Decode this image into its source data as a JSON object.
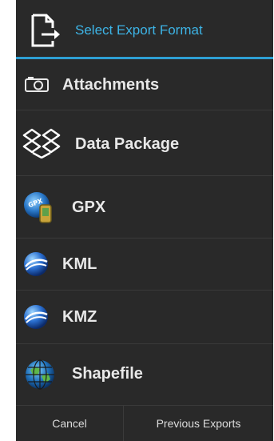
{
  "dialog": {
    "title": "Select Export Format",
    "title_color": "#3db4e6",
    "accent_rule_color": "#2e9fd3",
    "background": "#292929",
    "header_icon": "export-document-icon"
  },
  "formats": [
    {
      "label": "Attachments",
      "icon": "camera-icon"
    },
    {
      "label": "Data Package",
      "icon": "dropbox-box-icon"
    },
    {
      "label": "GPX",
      "icon": "gpx-device-icon"
    },
    {
      "label": "KML",
      "icon": "google-earth-icon"
    },
    {
      "label": "KMZ",
      "icon": "google-earth-icon"
    },
    {
      "label": "Shapefile",
      "icon": "globe-grid-icon"
    }
  ],
  "footer": {
    "cancel_label": "Cancel",
    "previous_label": "Previous Exports"
  }
}
